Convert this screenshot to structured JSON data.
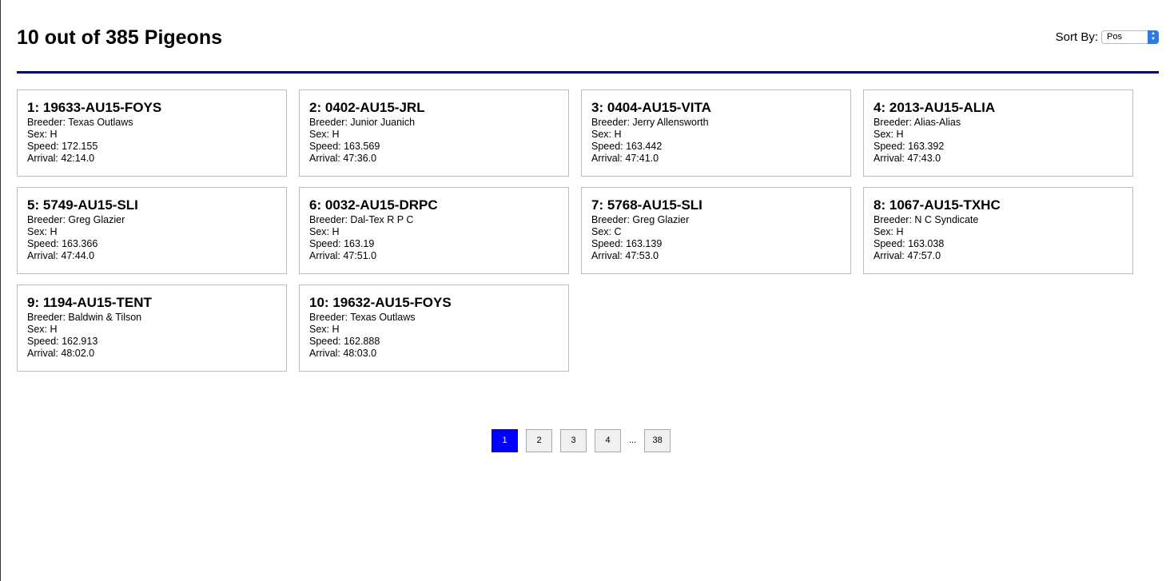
{
  "header": {
    "title": "10 out of 385 Pigeons",
    "sort_label": "Sort By:",
    "sort_value": "Pos"
  },
  "labels": {
    "breeder": "Breeder: ",
    "sex": "Sex: ",
    "speed": "Speed: ",
    "arrival": "Arrival: "
  },
  "pigeons": [
    {
      "pos": "1",
      "band": "19633-AU15-FOYS",
      "breeder": "Texas Outlaws",
      "sex": "H",
      "speed": "172.155",
      "arrival": "42:14.0"
    },
    {
      "pos": "2",
      "band": "0402-AU15-JRL",
      "breeder": "Junior Juanich",
      "sex": "H",
      "speed": "163.569",
      "arrival": "47:36.0"
    },
    {
      "pos": "3",
      "band": "0404-AU15-VITA",
      "breeder": "Jerry Allensworth",
      "sex": "H",
      "speed": "163.442",
      "arrival": "47:41.0"
    },
    {
      "pos": "4",
      "band": "2013-AU15-ALIA",
      "breeder": "Alias-Alias",
      "sex": "H",
      "speed": "163.392",
      "arrival": "47:43.0"
    },
    {
      "pos": "5",
      "band": "5749-AU15-SLI",
      "breeder": "Greg Glazier",
      "sex": "H",
      "speed": "163.366",
      "arrival": "47:44.0"
    },
    {
      "pos": "6",
      "band": "0032-AU15-DRPC",
      "breeder": "Dal-Tex R P C",
      "sex": "H",
      "speed": "163.19",
      "arrival": "47:51.0"
    },
    {
      "pos": "7",
      "band": "5768-AU15-SLI",
      "breeder": "Greg Glazier",
      "sex": "C",
      "speed": "163.139",
      "arrival": "47:53.0"
    },
    {
      "pos": "8",
      "band": "1067-AU15-TXHC",
      "breeder": "N C Syndicate",
      "sex": "H",
      "speed": "163.038",
      "arrival": "47:57.0"
    },
    {
      "pos": "9",
      "band": "1194-AU15-TENT",
      "breeder": "Baldwin & Tilson",
      "sex": "H",
      "speed": "162.913",
      "arrival": "48:02.0"
    },
    {
      "pos": "10",
      "band": "19632-AU15-FOYS",
      "breeder": "Texas Outlaws",
      "sex": "H",
      "speed": "162.888",
      "arrival": "48:03.0"
    }
  ],
  "pagination": {
    "pages": [
      "1",
      "2",
      "3",
      "4"
    ],
    "active": "1",
    "ellipsis": "...",
    "last": "38"
  },
  "colors": {
    "header_rule": "#00008b",
    "active_page": "#0000ff",
    "select_accent": "#2f78e6"
  }
}
